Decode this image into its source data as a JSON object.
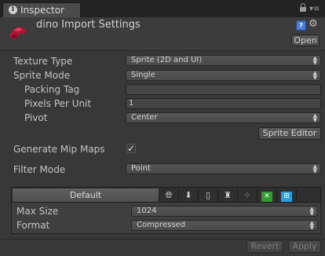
{
  "window": {
    "tab_title": "Inspector"
  },
  "header": {
    "title": "dino Import Settings",
    "open_label": "Open"
  },
  "settings": {
    "texture_type_label": "Texture Type",
    "texture_type_value": "Sprite (2D and UI)",
    "sprite_mode_label": "Sprite Mode",
    "sprite_mode_value": "Single",
    "packing_tag_label": "Packing Tag",
    "packing_tag_value": "",
    "pixels_per_unit_label": "Pixels Per Unit",
    "pixels_per_unit_value": "1",
    "pivot_label": "Pivot",
    "pivot_value": "Center",
    "sprite_editor_label": "Sprite Editor",
    "generate_mip_maps_label": "Generate Mip Maps",
    "generate_mip_maps_checked": true,
    "filter_mode_label": "Filter Mode",
    "filter_mode_value": "Point"
  },
  "platform": {
    "default_tab_label": "Default",
    "icons": [
      "web-icon",
      "download-icon",
      "mobile-icon",
      "android-icon",
      "blackberry-icon",
      "xbox-icon",
      "windows-icon"
    ],
    "max_size_label": "Max Size",
    "max_size_value": "1024",
    "format_label": "Format",
    "format_value": "Compressed"
  },
  "footer": {
    "revert_label": "Revert",
    "apply_label": "Apply"
  },
  "colors": {
    "background": "#383838",
    "xbox_green": "#2f9e2f",
    "windows_blue": "#2aa0dc"
  }
}
